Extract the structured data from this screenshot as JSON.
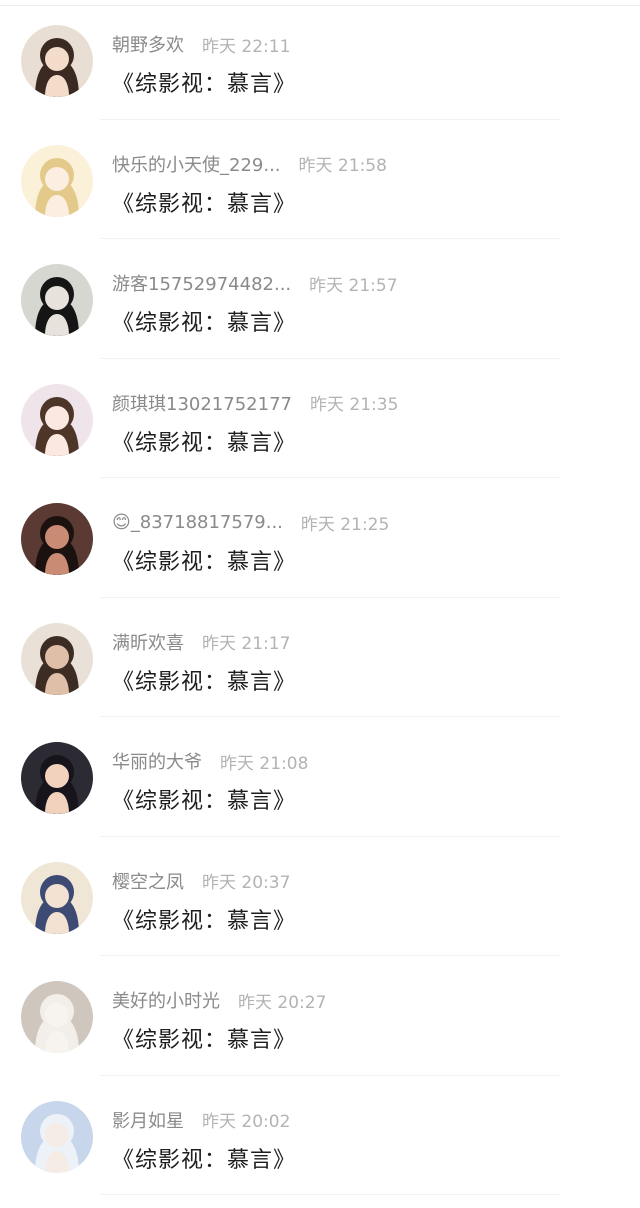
{
  "comments": [
    {
      "username": "朝野多欢",
      "time": "昨天 22:11",
      "text": "《综影视：慕言》",
      "avatar": {
        "bg": "#e9ded4",
        "hair": "#3a2a22",
        "skin": "#f4dccb"
      }
    },
    {
      "username": "快乐的小天使_229...",
      "time": "昨天 21:58",
      "text": "《综影视：慕言》",
      "avatar": {
        "bg": "#fbf1d9",
        "hair": "#e3c98a",
        "skin": "#fdeee2"
      }
    },
    {
      "username": "游客15752974482...",
      "time": "昨天 21:57",
      "text": "《综影视：慕言》",
      "avatar": {
        "bg": "#d7d7d2",
        "hair": "#151515",
        "skin": "#e8e2dc"
      }
    },
    {
      "username": "颜琪琪13021752177",
      "time": "昨天 21:35",
      "text": "《综影视：慕言》",
      "avatar": {
        "bg": "#efe4ea",
        "hair": "#4d3528",
        "skin": "#fbe9e1"
      }
    },
    {
      "username": "😊_83718817579...",
      "time": "昨天 21:25",
      "text": "《综影视：慕言》",
      "avatar": {
        "bg": "#5b3a33",
        "hair": "#1b1210",
        "skin": "#c98b74"
      }
    },
    {
      "username": "满昕欢喜",
      "time": "昨天 21:17",
      "text": "《综影视：慕言》",
      "avatar": {
        "bg": "#e9e0d7",
        "hair": "#3c2c24",
        "skin": "#e0bfa8"
      }
    },
    {
      "username": "华丽的大爷",
      "time": "昨天 21:08",
      "text": "《综影视：慕言》",
      "avatar": {
        "bg": "#2c2a33",
        "hair": "#17141c",
        "skin": "#f2d2bd"
      }
    },
    {
      "username": "樱空之凤",
      "time": "昨天 20:37",
      "text": "《综影视：慕言》",
      "avatar": {
        "bg": "#efe6d6",
        "hair": "#3d4a73",
        "skin": "#f3e1d2"
      }
    },
    {
      "username": "美好的小时光",
      "time": "昨天 20:27",
      "text": "《综影视：慕言》",
      "avatar": {
        "bg": "#cfc6bd",
        "hair": "#f2eee9",
        "skin": "#f7f3ee"
      }
    },
    {
      "username": "影月如星",
      "time": "昨天 20:02",
      "text": "《综影视：慕言》",
      "avatar": {
        "bg": "#c7d6ea",
        "hair": "#edf1f8",
        "skin": "#f6ece6"
      }
    }
  ]
}
